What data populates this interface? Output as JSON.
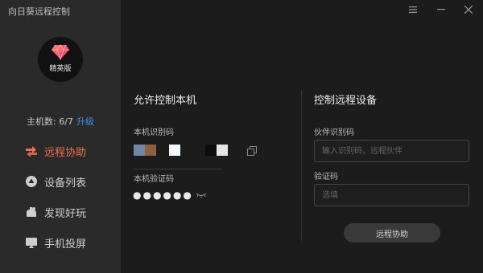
{
  "app": {
    "title": "向日葵远程控制"
  },
  "account": {
    "edition": "精英版",
    "host_count_label": "主机数: 6/7",
    "upgrade_label": "升级"
  },
  "nav": {
    "items": [
      {
        "label": "远程协助",
        "icon": "remote-assist-icon",
        "active": true
      },
      {
        "label": "设备列表",
        "icon": "device-list-icon",
        "active": false
      },
      {
        "label": "发现好玩",
        "icon": "discover-icon",
        "active": false
      },
      {
        "label": "手机投屏",
        "icon": "screen-cast-icon",
        "active": false
      }
    ]
  },
  "window_controls": [
    "menu-icon",
    "minimize-icon",
    "close-icon"
  ],
  "allow_control": {
    "title": "允许控制本机",
    "id_label": "本机识别码",
    "code_label": "本机验证码",
    "code_value": "●●●●●●"
  },
  "remote_control": {
    "title": "控制远程设备",
    "partner_label": "伙伴识别码",
    "partner_placeholder": "输入识别码，远程伙伴",
    "code_label": "验证码",
    "code_placeholder": "选填",
    "connect_label": "远程协助"
  },
  "colors": {
    "accent": "#ef6f4c",
    "link": "#3d8ee8",
    "sidebar_bg": "#2a2a2a",
    "main_bg": "#1c1c1c"
  }
}
